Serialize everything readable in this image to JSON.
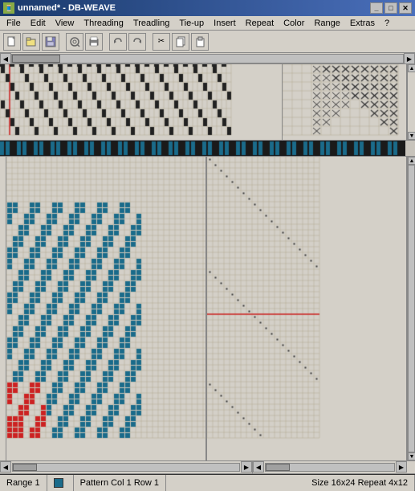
{
  "titlebar": {
    "title": "unnamed* - DB-WEAVE",
    "icon": "🧵",
    "minimize_label": "_",
    "maximize_label": "□",
    "close_label": "✕"
  },
  "menubar": {
    "items": [
      "File",
      "Edit",
      "View",
      "Threading",
      "Treadling",
      "Tie-up",
      "Insert",
      "Repeat",
      "Color",
      "Range",
      "Extras",
      "?"
    ]
  },
  "toolbar": {
    "buttons": [
      {
        "name": "new",
        "icon": "📄"
      },
      {
        "name": "open",
        "icon": "📂"
      },
      {
        "name": "save",
        "icon": "💾"
      },
      {
        "name": "print-preview",
        "icon": "🔍"
      },
      {
        "name": "print",
        "icon": "🖨"
      },
      {
        "name": "undo",
        "icon": "↩"
      },
      {
        "name": "redo",
        "icon": "↪"
      },
      {
        "name": "cut",
        "icon": "✂"
      },
      {
        "name": "copy",
        "icon": "📋"
      },
      {
        "name": "paste",
        "icon": "📌"
      }
    ]
  },
  "statusbar": {
    "range_label": "Range 1",
    "pattern_label": "Pattern Col 1 Row 1",
    "size_label": "Size 16x24 Repeat 4x12",
    "color_hex": "#1a6b8a"
  },
  "colors": {
    "grid_line": "#b0a890",
    "grid_bg": "#d4d0c8",
    "cell_filled_blue": "#1a6b8a",
    "cell_filled_red": "#cc2222",
    "cell_filled_black": "#222222",
    "tieup_mark": "#444444",
    "red_line": "#cc2222",
    "accent_orange": "#c87820"
  }
}
